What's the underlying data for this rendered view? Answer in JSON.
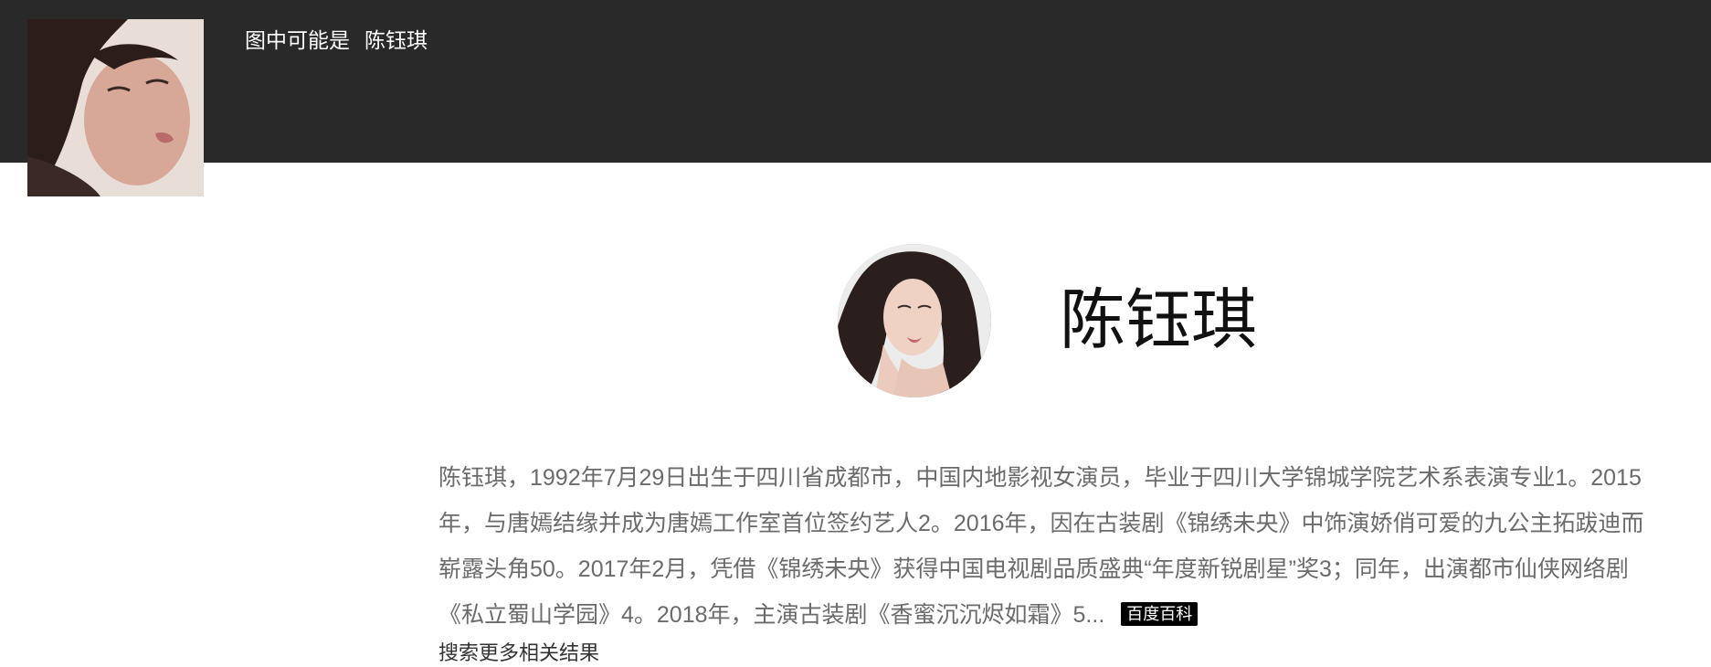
{
  "header": {
    "guess_label": "图中可能是",
    "guess_name": "陈钰琪",
    "thumbnail_icon": "face-thumbnail"
  },
  "profile": {
    "name": "陈钰琪",
    "avatar_icon": "portrait-avatar",
    "bio": "陈钰琪，1992年7月29日出生于四川省成都市，中国内地影视女演员，毕业于四川大学锦城学院艺术系表演专业1。2015年，与唐嫣结缘并成为唐嫣工作室首位签约艺人2。2016年，因在古装剧《锦绣未央》中饰演娇俏可爱的九公主拓跋迪而崭露头角50。2017年2月，凭借《锦绣未央》获得中国电视剧品质盛典“年度新锐剧星”奖3；同年，出演都市仙侠网络剧《私立蜀山学园》4。2018年，主演古装剧《香蜜沉沉烬如霜》5...",
    "source_badge": "百度百科"
  },
  "more": {
    "label": "搜索更多相关结果"
  },
  "colors": {
    "top_bar": "#292929",
    "bio_text": "#6b6b6b",
    "badge_bg": "#000000"
  }
}
